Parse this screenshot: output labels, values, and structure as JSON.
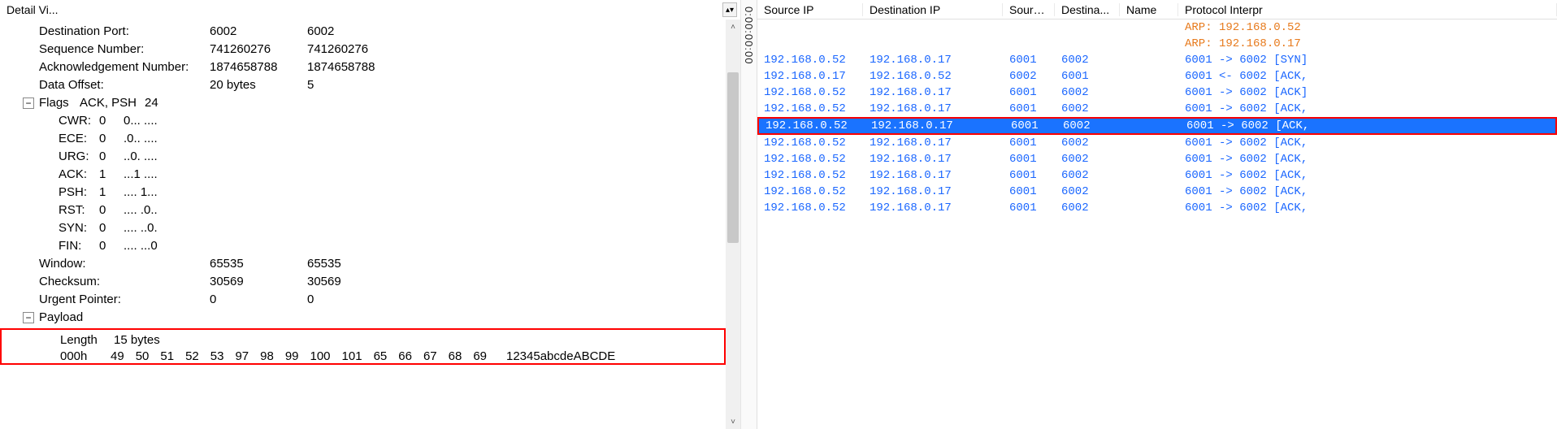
{
  "detail_panel": {
    "title": "Detail Vi...",
    "rows": {
      "dest_port": {
        "label": "Destination Port:",
        "v1": "6002",
        "v2": "6002"
      },
      "seq": {
        "label": "Sequence Number:",
        "v1": "741260276",
        "v2": "741260276"
      },
      "ack": {
        "label": "Acknowledgement Number:",
        "v1": "1874658788",
        "v2": "1874658788"
      },
      "data_off": {
        "label": "Data Offset:",
        "v1": "20 bytes",
        "v2": "5"
      },
      "flags_hdr": {
        "label": "Flags",
        "extra": "ACK, PSH",
        "val": "24"
      },
      "cwr": {
        "label": "CWR:",
        "v": "0",
        "bits": "0... ...."
      },
      "ece": {
        "label": "ECE:",
        "v": "0",
        "bits": ".0.. ...."
      },
      "urg": {
        "label": "URG:",
        "v": "0",
        "bits": "..0. ...."
      },
      "ackf": {
        "label": "ACK:",
        "v": "1",
        "bits": "...1 ...."
      },
      "psh": {
        "label": "PSH:",
        "v": "1",
        "bits": ".... 1..."
      },
      "rst": {
        "label": "RST:",
        "v": "0",
        "bits": ".... .0.."
      },
      "syn": {
        "label": "SYN:",
        "v": "0",
        "bits": ".... ..0."
      },
      "fin": {
        "label": "FIN:",
        "v": "0",
        "bits": ".... ...0"
      },
      "window": {
        "label": "Window:",
        "v1": "65535",
        "v2": "65535"
      },
      "cksum": {
        "label": "Checksum:",
        "v1": "30569",
        "v2": "30569"
      },
      "urgptr": {
        "label": "Urgent Pointer:",
        "v1": "0",
        "v2": "0"
      },
      "payload": {
        "label": "Payload"
      },
      "length": {
        "label": "Length",
        "v": "15 bytes"
      },
      "hex": {
        "offset": "000h",
        "bytes": [
          "49",
          "50",
          "51",
          "52",
          "53",
          "97",
          "98",
          "99",
          "100",
          "101",
          "65",
          "66",
          "67",
          "68",
          "69"
        ],
        "ascii": "12345abcdeABCDE"
      }
    }
  },
  "time_ruler": "0:00:00:00",
  "packet_list": {
    "headers": {
      "src": "Source IP",
      "dst": "Destination IP",
      "sp": "Sourc...",
      "dp": "Destina...",
      "name": "Name",
      "proto": "Protocol Interpr"
    },
    "rows": [
      {
        "type": "arp",
        "proto": "ARP: 192.168.0.52"
      },
      {
        "type": "arp",
        "proto": "ARP: 192.168.0.17"
      },
      {
        "src": "192.168.0.52",
        "dst": "192.168.0.17",
        "sp": "6001",
        "dp": "6002",
        "name": "",
        "proto": "6001 -> 6002 [SYN]"
      },
      {
        "src": "192.168.0.17",
        "dst": "192.168.0.52",
        "sp": "6002",
        "dp": "6001",
        "name": "",
        "proto": "6001 <- 6002 [ACK,"
      },
      {
        "src": "192.168.0.52",
        "dst": "192.168.0.17",
        "sp": "6001",
        "dp": "6002",
        "name": "",
        "proto": "6001 -> 6002 [ACK]"
      },
      {
        "src": "192.168.0.52",
        "dst": "192.168.0.17",
        "sp": "6001",
        "dp": "6002",
        "name": "",
        "proto": "6001 -> 6002 [ACK,"
      },
      {
        "src": "192.168.0.52",
        "dst": "192.168.0.17",
        "sp": "6001",
        "dp": "6002",
        "name": "",
        "proto": "6001 -> 6002 [ACK,",
        "selected": true
      },
      {
        "src": "192.168.0.52",
        "dst": "192.168.0.17",
        "sp": "6001",
        "dp": "6002",
        "name": "",
        "proto": "6001 -> 6002 [ACK,"
      },
      {
        "src": "192.168.0.52",
        "dst": "192.168.0.17",
        "sp": "6001",
        "dp": "6002",
        "name": "",
        "proto": "6001 -> 6002 [ACK,"
      },
      {
        "src": "192.168.0.52",
        "dst": "192.168.0.17",
        "sp": "6001",
        "dp": "6002",
        "name": "",
        "proto": "6001 -> 6002 [ACK,"
      },
      {
        "src": "192.168.0.52",
        "dst": "192.168.0.17",
        "sp": "6001",
        "dp": "6002",
        "name": "",
        "proto": "6001 -> 6002 [ACK,"
      },
      {
        "src": "192.168.0.52",
        "dst": "192.168.0.17",
        "sp": "6001",
        "dp": "6002",
        "name": "",
        "proto": "6001 -> 6002 [ACK,"
      }
    ]
  }
}
